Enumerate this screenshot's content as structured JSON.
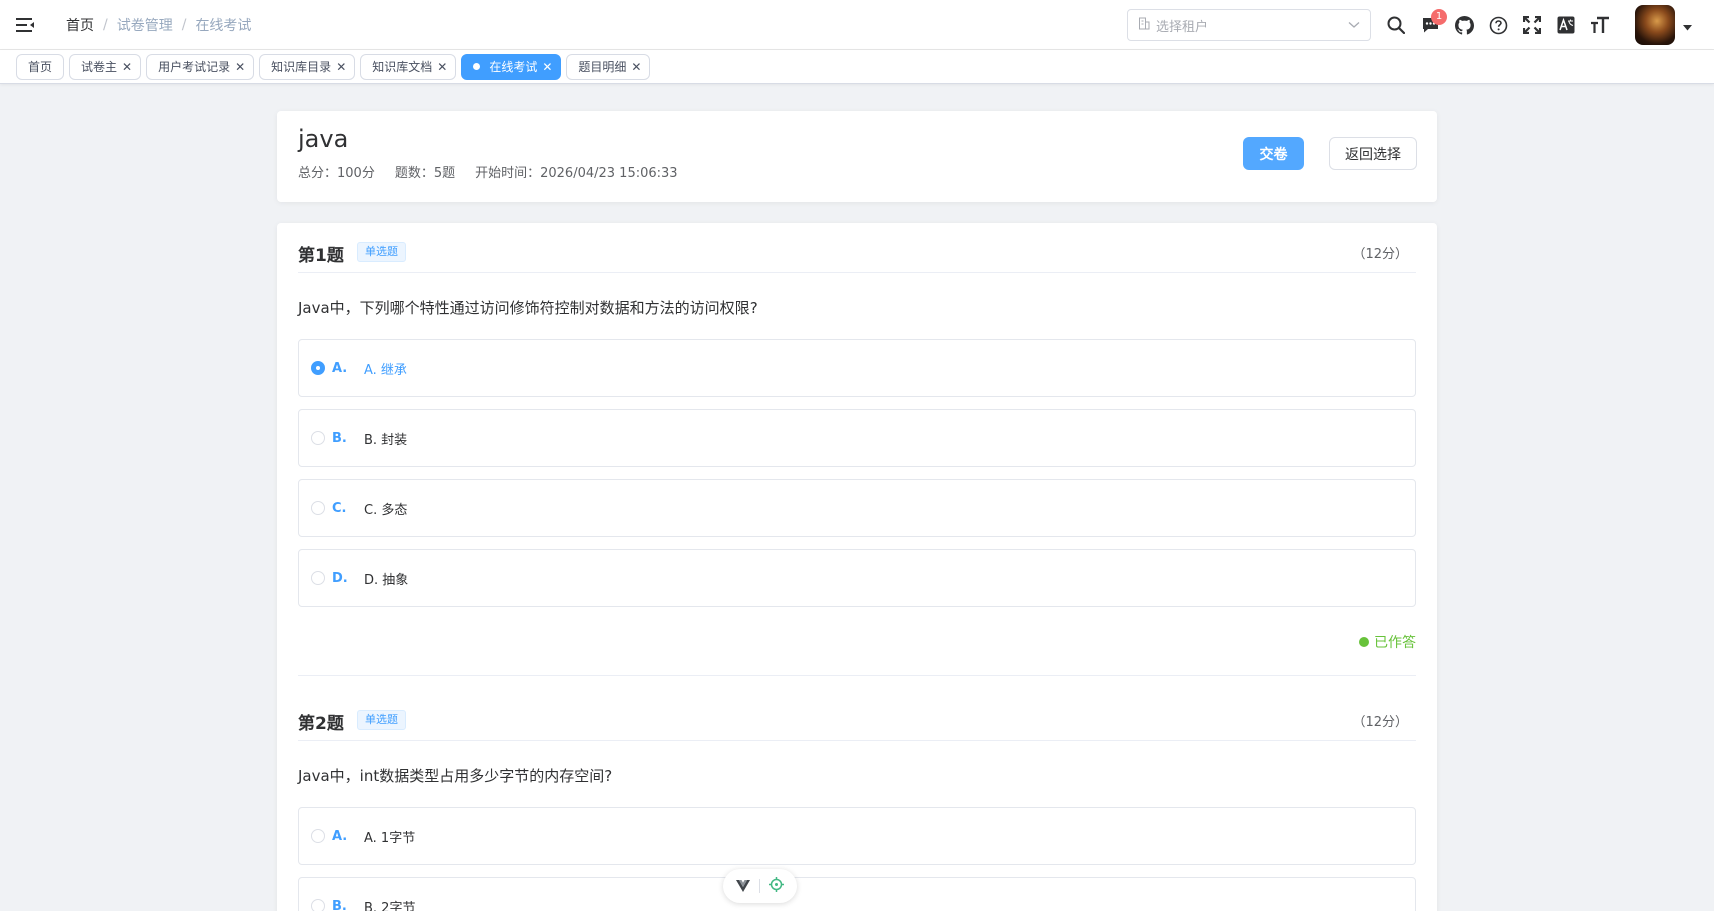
{
  "breadcrumb": [
    "首页",
    "试卷管理",
    "在线考试"
  ],
  "tenant_select": {
    "placeholder": "选择租户"
  },
  "notifications": {
    "count": "1"
  },
  "tags": [
    {
      "label": "首页"
    },
    {
      "label": "试卷主"
    },
    {
      "label": "用户考试记录"
    },
    {
      "label": "知识库目录"
    },
    {
      "label": "知识库文档"
    },
    {
      "label": "在线考试",
      "active": true
    },
    {
      "label": "题目明细"
    }
  ],
  "exam": {
    "title": "java",
    "total_score": "总分：100分",
    "question_count": "题数：5题",
    "start_time": "开始时间：2026/04/23 15:06:33",
    "submit_label": "交卷",
    "back_label": "返回选择"
  },
  "questions": [
    {
      "number": "第1题",
      "type": "单选题",
      "score": "（12分）",
      "text": "Java中，下列哪个特性通过访问修饰符控制对数据和方法的访问权限?",
      "options": [
        {
          "letter": "A.",
          "text": "A. 继承",
          "selected": true
        },
        {
          "letter": "B.",
          "text": "B. 封装"
        },
        {
          "letter": "C.",
          "text": "C. 多态"
        },
        {
          "letter": "D.",
          "text": "D. 抽象"
        }
      ],
      "status": "已作答"
    },
    {
      "number": "第2题",
      "type": "单选题",
      "score": "（12分）",
      "text": "Java中，int数据类型占用多少字节的内存空间?",
      "options": [
        {
          "letter": "A.",
          "text": "A. 1字节"
        },
        {
          "letter": "B.",
          "text": "B. 2字节"
        }
      ]
    }
  ],
  "colors": {
    "primary": "#409eff",
    "success": "#67c23a",
    "danger": "#f56c6c"
  },
  "icons": [
    "hamburger-icon",
    "building-icon",
    "chevron-down-icon",
    "search-icon",
    "message-icon",
    "github-icon",
    "help-icon",
    "fullscreen-icon",
    "translate-icon",
    "font-size-icon",
    "caret-down-icon",
    "close-icon",
    "vue-icon",
    "target-icon"
  ]
}
